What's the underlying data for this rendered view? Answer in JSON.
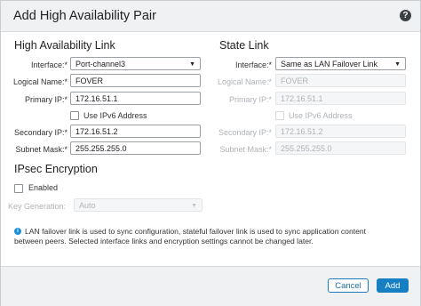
{
  "dialog": {
    "title": "Add High Availability Pair",
    "help_icon": "help-icon"
  },
  "ha_link": {
    "heading": "High Availability Link",
    "interface_label": "Interface:*",
    "interface_value": "Port-channel3",
    "logical_name_label": "Logical Name:*",
    "logical_name_value": "FOVER",
    "primary_ip_label": "Primary IP:*",
    "primary_ip_value": "172.16.51.1",
    "ipv6_label": "Use IPv6 Address",
    "secondary_ip_label": "Secondary IP:*",
    "secondary_ip_value": "172.16.51.2",
    "subnet_mask_label": "Subnet Mask:*",
    "subnet_mask_value": "255.255.255.0"
  },
  "state_link": {
    "heading": "State Link",
    "interface_label": "Interface:*",
    "interface_value": "Same as LAN Failover Link",
    "logical_name_label": "Logical Name:*",
    "logical_name_value": "FOVER",
    "primary_ip_label": "Primary IP:*",
    "primary_ip_value": "172.16.51.1",
    "ipv6_label": "Use IPv6 Address",
    "secondary_ip_label": "Secondary IP:*",
    "secondary_ip_value": "172.16.51.2",
    "subnet_mask_label": "Subnet Mask:*",
    "subnet_mask_value": "255.255.255.0"
  },
  "ipsec": {
    "heading": "IPsec Encryption",
    "enabled_label": "Enabled",
    "key_gen_label": "Key Generation:",
    "key_gen_value": "Auto"
  },
  "info": {
    "icon": "info-icon",
    "text": "LAN failover link is used to sync configuration, stateful failover link is used to sync application content between peers. Selected interface links and encryption settings cannot be changed later."
  },
  "footer": {
    "cancel_label": "Cancel",
    "add_label": "Add"
  },
  "colors": {
    "primary": "#1780c4",
    "header_bg": "#f0f1f2",
    "info": "#1e8fd6"
  }
}
